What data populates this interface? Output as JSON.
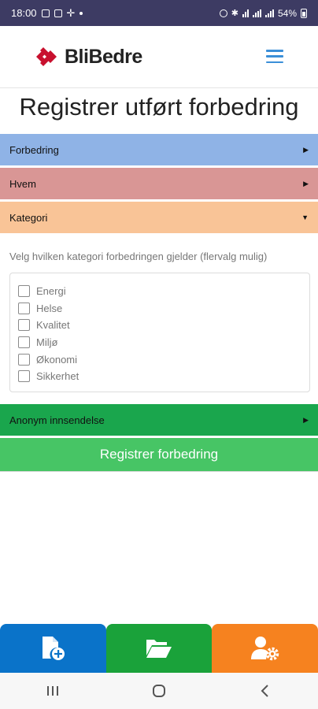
{
  "status_bar": {
    "time": "18:00",
    "battery": "54%"
  },
  "header": {
    "logo_text": "BliBedre",
    "menu_icon": "hamburger-icon"
  },
  "page": {
    "title": "Registrer utført forbedring"
  },
  "sections": {
    "forbedring": {
      "label": "Forbedring",
      "state": "collapsed",
      "color": "#8fb3e6"
    },
    "hvem": {
      "label": "Hvem",
      "state": "collapsed",
      "color": "#d99695"
    },
    "kategori": {
      "label": "Kategori",
      "state": "expanded",
      "color": "#f9c497"
    },
    "anonym": {
      "label": "Anonym innsendelse",
      "state": "collapsed",
      "color": "#1aa64d"
    }
  },
  "kategori": {
    "instruction": "Velg hvilken kategori forbedringen gjelder (flervalg mulig)",
    "options": [
      {
        "label": "Energi",
        "checked": false
      },
      {
        "label": "Helse",
        "checked": false
      },
      {
        "label": "Kvalitet",
        "checked": false
      },
      {
        "label": "Miljø",
        "checked": false
      },
      {
        "label": "Økonomi",
        "checked": false
      },
      {
        "label": "Sikkerhet",
        "checked": false
      }
    ]
  },
  "submit_button": {
    "label": "Registrer forbedring",
    "color": "#47c565"
  },
  "tab_bar": {
    "tabs": [
      {
        "icon": "new-document-icon",
        "color": "#0a73c9"
      },
      {
        "icon": "open-folder-icon",
        "color": "#1aa23a"
      },
      {
        "icon": "user-settings-icon",
        "color": "#f6821f"
      }
    ]
  },
  "colors": {
    "status_bar": "#3d3b63",
    "brand_red": "#c8102e",
    "menu_blue": "#3b8fd8"
  }
}
